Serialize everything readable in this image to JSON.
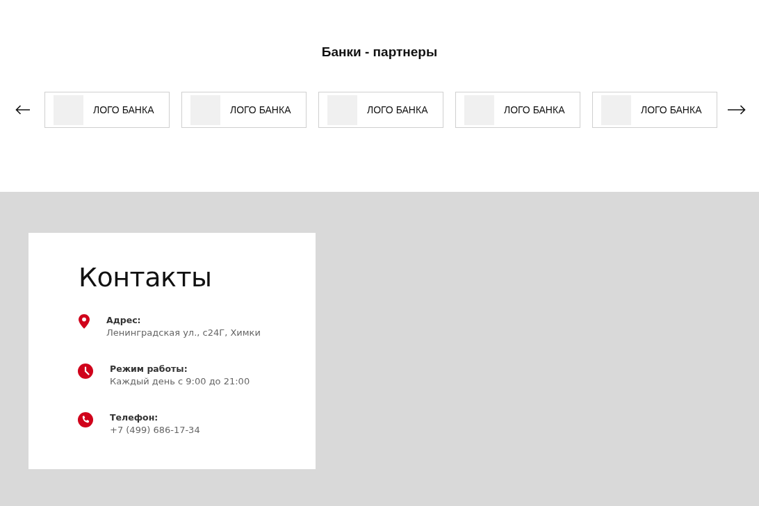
{
  "partners": {
    "title": "Банки - партнеры",
    "banks": [
      {
        "name": "ЛОГО БАНКА"
      },
      {
        "name": "ЛОГО БАНКА"
      },
      {
        "name": "ЛОГО БАНКА"
      },
      {
        "name": "ЛОГО БАНКА"
      },
      {
        "name": "ЛОГО БАНКА"
      }
    ]
  },
  "contacts": {
    "title": "Контакты",
    "items": [
      {
        "kind": "address",
        "label": "Адрес:",
        "value": "Ленинградская ул., с24Г, Химки"
      },
      {
        "kind": "hours",
        "label": "Режим работы:",
        "value": "Каждый день с 9:00 до 21:00"
      },
      {
        "kind": "phone",
        "label": "Телефон:",
        "value": "+7 (499) 686-17-34"
      }
    ]
  }
}
